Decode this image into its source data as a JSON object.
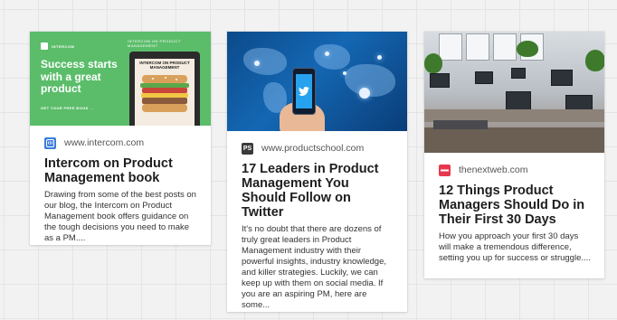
{
  "cards": [
    {
      "thumbnail": {
        "brand": "INTERCOM",
        "heading": "INTERCOM ON PRODUCT MANAGEMENT",
        "hero": "Success starts with a great product",
        "cta": "GET YOUR FREE BOOK →",
        "book_title": "INTERCOM ON PRODUCT MANAGEMENT"
      },
      "favicon_icon": "intercom-logo-icon",
      "domain": "www.intercom.com",
      "title": "Intercom on Product Management book",
      "description": "Drawing from some of the best posts on our blog, the Intercom on Product Management book offers guidance on the tough decisions you need to make as a PM...."
    },
    {
      "thumbnail": {
        "phone_icon": "twitter-bird-icon"
      },
      "favicon_icon": "productschool-logo-icon",
      "favicon_text": "PS",
      "domain": "www.productschool.com",
      "title": "17 Leaders in Product Management You Should Follow on Twitter",
      "description": "It's no doubt that there are dozens of truly great leaders in Product Management industry with their powerful insights, industry knowledge, and killer strategies. Luckily, we can keep up with them on social media. If you are an aspiring PM, here are some..."
    },
    {
      "favicon_icon": "thenextweb-logo-icon",
      "domain": "thenextweb.com",
      "title": "12 Things Product Managers Should Do in Their First 30 Days",
      "description": "How you approach your first 30 days will make a tremendous difference, setting you up for success or struggle...."
    }
  ],
  "colors": {
    "intercom_green": "#5bbd6a",
    "intercom_favicon": "#3b7ddd",
    "productschool_favicon": "#3a3a3a",
    "thenextweb_favicon": "#e8384f",
    "twitter_blue": "#27a2ee"
  }
}
